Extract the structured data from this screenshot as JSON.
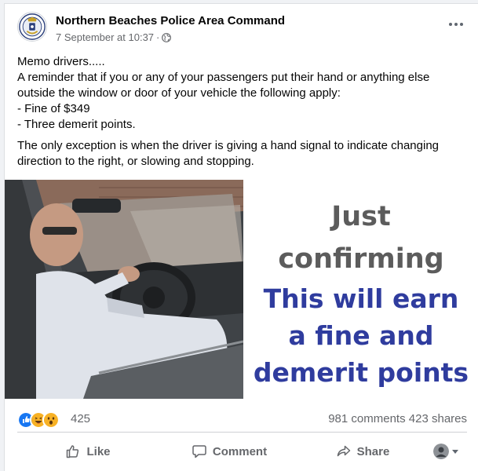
{
  "post": {
    "page_name": "Northern Beaches Police Area Command",
    "date": "7 September at 10:37",
    "meta_separator": "·",
    "privacy_icon": "globe-icon",
    "more_icon": "more-options-icon",
    "text_lines": [
      "Memo drivers.....",
      "A reminder that if you or any of your passengers put their hand or anything else outside the window or door of your vehicle the following apply:",
      "- Fine of $349",
      "- Three demerit points."
    ],
    "text_para2": "The only exception is when the driver is giving a hand signal to indicate changing direction to the right, or slowing and stopping."
  },
  "image": {
    "caption_line1": "Just",
    "caption_line2": "confirming",
    "caption_line3": "This will earn",
    "caption_line4": "a fine and",
    "caption_line5": "demerit points",
    "gray_color": "#5c5c5c",
    "blue_color": "#2f3c9e"
  },
  "engagement": {
    "reaction_icons": [
      "like-reaction-icon",
      "haha-reaction-icon",
      "wow-reaction-icon"
    ],
    "reaction_count": "425",
    "comments": "981 comments",
    "shares": "423 shares"
  },
  "actions": {
    "like": "Like",
    "comment": "Comment",
    "share": "Share"
  },
  "colors": {
    "brand_blue": "#1877f2",
    "meta_gray": "#65676b"
  }
}
